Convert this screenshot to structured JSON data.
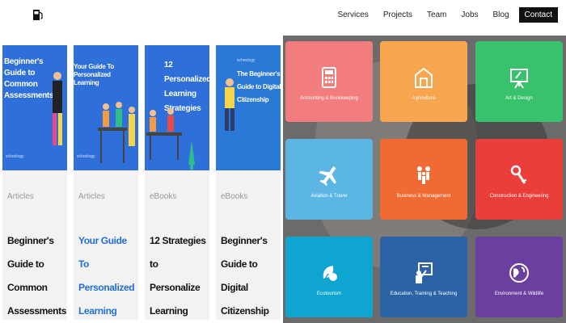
{
  "header": {
    "nav": [
      {
        "label": "Services"
      },
      {
        "label": "Projects"
      },
      {
        "label": "Team"
      },
      {
        "label": "Jobs"
      },
      {
        "label": "Blog"
      },
      {
        "label": "Contact"
      }
    ]
  },
  "cards": [
    {
      "thumb_title": "Beginner's Guide to Common Assessments",
      "thumb_brand": "schoology",
      "category": "Articles",
      "title": "Beginner's Guide to Common Assessments"
    },
    {
      "thumb_title": "Your Guide To Personalized Learning",
      "thumb_brand": "schoology",
      "category": "Articles",
      "title": "Your Guide To Personalized Learning"
    },
    {
      "thumb_title": "12 Personalized Learning Strategies",
      "thumb_brand": "",
      "category": "eBooks",
      "title": "12 Strategies to Personalize Learning"
    },
    {
      "thumb_title": "The Beginner's Guide to Digital Citizenship",
      "thumb_brand": "schoology",
      "category": "eBooks",
      "title": "Beginner's Guide to Digital Citizenship"
    }
  ],
  "tiles": [
    {
      "label": "Accounting & Bookkeeping",
      "icon": "calculator-icon",
      "color": "#f37c7f"
    },
    {
      "label": "Agriculture",
      "icon": "barn-icon",
      "color": "#f7a54e"
    },
    {
      "label": "Art & Design",
      "icon": "easel-icon",
      "color": "#39c26c"
    },
    {
      "label": "Aviation & Travel",
      "icon": "airplane-icon",
      "color": "#5cb6e3"
    },
    {
      "label": "Business & Management",
      "icon": "business-icon",
      "color": "#f26a33"
    },
    {
      "label": "Construction & Engineering",
      "icon": "wrench-icon",
      "color": "#ea3e3b"
    },
    {
      "label": "Ecotourism",
      "icon": "leaf-icon",
      "color": "#0ea6d0"
    },
    {
      "label": "Education, Training & Teaching",
      "icon": "teacher-icon",
      "color": "#2c63a6"
    },
    {
      "label": "Environment & Wildlife",
      "icon": "globe-icon",
      "color": "#6a3fa0"
    }
  ]
}
